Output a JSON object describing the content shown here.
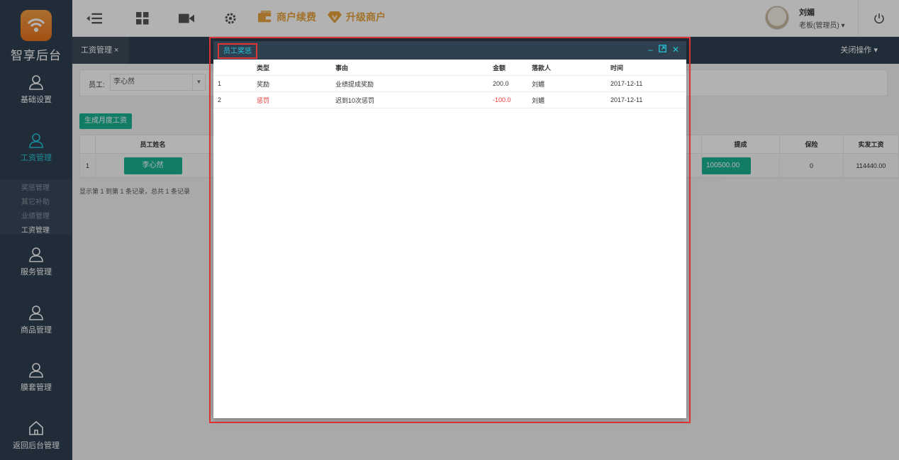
{
  "brand": {
    "name": "智享后台"
  },
  "topbar": {
    "links": [
      {
        "label": "商户续费",
        "icon": "wallet-icon"
      },
      {
        "label": "升级商户",
        "icon": "diamond-icon"
      }
    ],
    "user": {
      "name": "刘媚",
      "role": "老板(管理员) ▾"
    }
  },
  "sidebar": {
    "items": [
      {
        "label": "基础设置",
        "icon": "user-icon"
      },
      {
        "label": "工资管理",
        "icon": "user-icon"
      },
      {
        "label": "服务管理",
        "icon": "user-icon"
      },
      {
        "label": "商品管理",
        "icon": "user-icon"
      },
      {
        "label": "膜套管理",
        "icon": "user-icon"
      },
      {
        "label": "返回后台管理",
        "icon": "home-icon"
      }
    ],
    "submenu": [
      "奖惩管理",
      "其它补助",
      "业绩管理",
      "工资管理"
    ]
  },
  "tabs": {
    "active": "工资管理 ×",
    "close_ops": "关闭操作 ▾"
  },
  "filter": {
    "label": "员工:",
    "value": "李心然"
  },
  "generate_button": "生成月度工资",
  "table": {
    "headers": {
      "name": "员工姓名",
      "commission": "提成",
      "insurance": "保险",
      "net": "实发工资"
    },
    "row": {
      "index": "1",
      "name": "李心然",
      "commission": "100500.00",
      "insurance": "0",
      "net": "114440.00"
    }
  },
  "pagination_info": "显示第 1 到第 1 条记录，总共 1 条记录",
  "modal": {
    "title": "员工奖惩",
    "columns": [
      "类型",
      "事由",
      "金额",
      "落款人",
      "时间"
    ],
    "rows": [
      {
        "no": "1",
        "type": "奖励",
        "reason": "业绩提成奖励",
        "amount": "200.0",
        "signer": "刘媚",
        "date": "2017-12-11"
      },
      {
        "no": "2",
        "type": "惩罚",
        "reason": "迟到10次惩罚",
        "amount": "-100.0",
        "signer": "刘媚",
        "date": "2017-12-11"
      }
    ]
  },
  "colors": {
    "sidebar": "#2f4050",
    "accent": "#1ab394",
    "highlight": "#e03535",
    "warning": "#e8a33d"
  }
}
